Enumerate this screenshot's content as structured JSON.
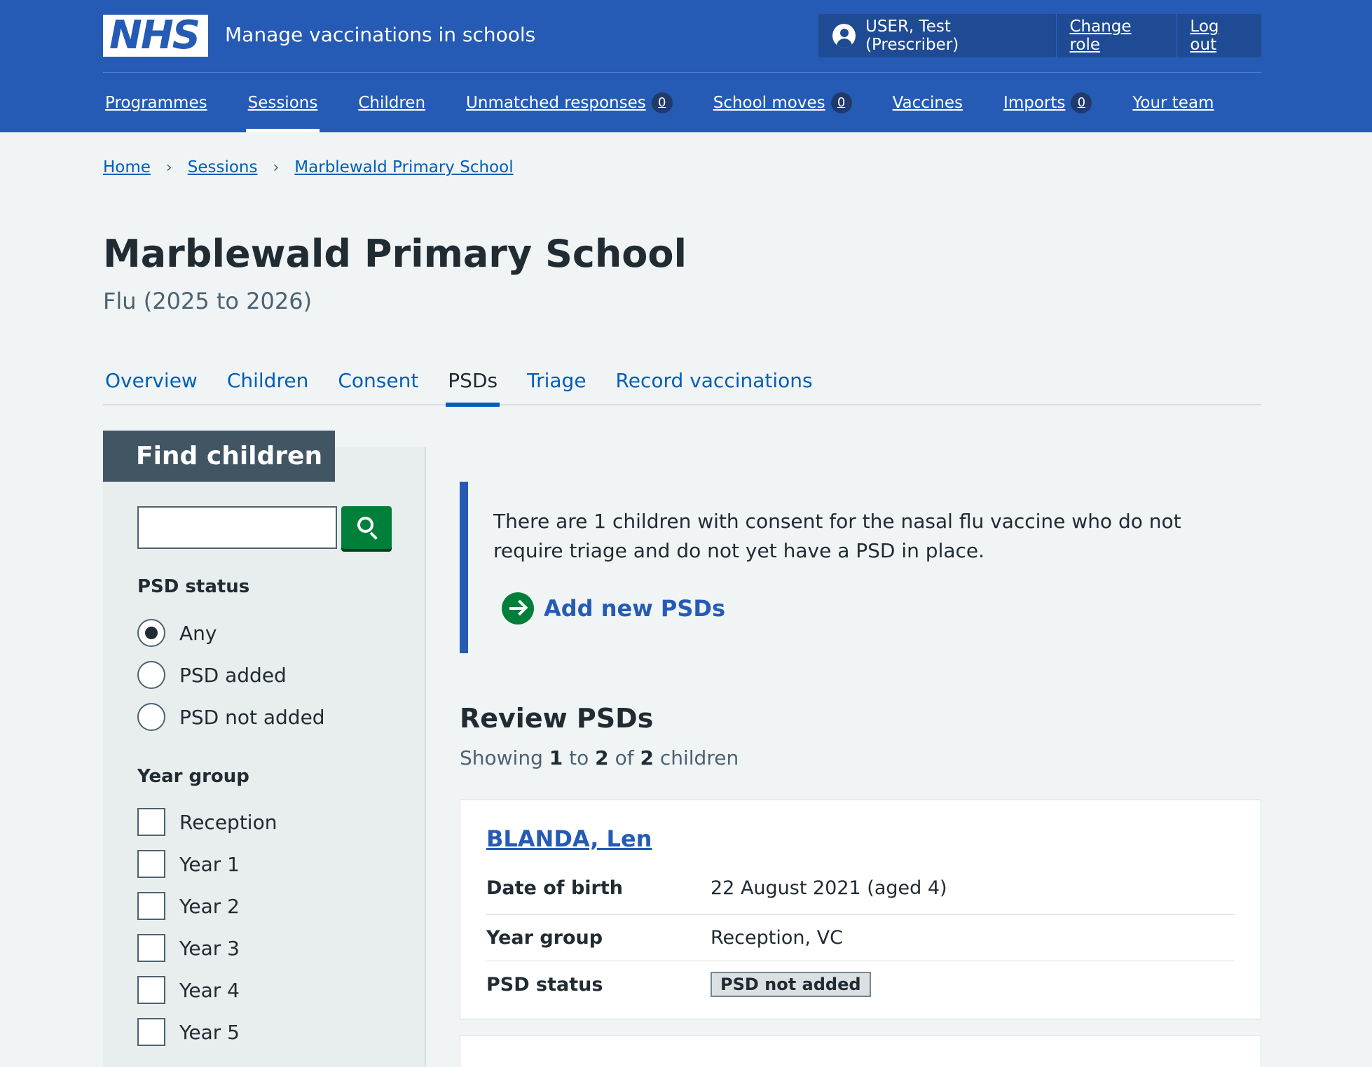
{
  "header": {
    "logo": "NHS",
    "service_name": "Manage vaccinations in schools",
    "user": "USER, Test (Prescriber)",
    "change_role": "Change role",
    "log_out": "Log out",
    "bg_color": "#255bb4"
  },
  "nav": {
    "items": [
      {
        "label": "Programmes"
      },
      {
        "label": "Sessions",
        "active": true
      },
      {
        "label": "Children"
      },
      {
        "label": "Unmatched responses",
        "badge": "0"
      },
      {
        "label": "School moves",
        "badge": "0"
      },
      {
        "label": "Vaccines"
      },
      {
        "label": "Imports",
        "badge": "0"
      },
      {
        "label": "Your team"
      }
    ]
  },
  "breadcrumb": [
    "Home",
    "Sessions",
    "Marblewald Primary School"
  ],
  "page": {
    "title": "Marblewald Primary School",
    "caption": "Flu (2025 to 2026)"
  },
  "tabs": [
    {
      "label": "Overview"
    },
    {
      "label": "Children"
    },
    {
      "label": "Consent"
    },
    {
      "label": "PSDs",
      "active": true
    },
    {
      "label": "Triage"
    },
    {
      "label": "Record vaccinations"
    }
  ],
  "filters": {
    "heading": "Find children",
    "search_value": "",
    "psd_status_label": "PSD status",
    "psd_status_options": [
      {
        "label": "Any",
        "checked": true
      },
      {
        "label": "PSD added",
        "checked": false
      },
      {
        "label": "PSD not added",
        "checked": false
      }
    ],
    "year_group_label": "Year group",
    "year_group_options": [
      "Reception",
      "Year 1",
      "Year 2",
      "Year 3",
      "Year 4",
      "Year 5"
    ]
  },
  "inset": {
    "text": "There are 1 children with consent for the nasal flu vaccine who do not require triage and do not yet have a PSD in place.",
    "action_label": "Add new PSDs"
  },
  "review": {
    "heading": "Review PSDs",
    "showing_prefix": "Showing",
    "from": "1",
    "to_word": "to",
    "to": "2",
    "of_word": "of",
    "total": "2",
    "suffix": "children"
  },
  "children": [
    {
      "name": "BLANDA, Len",
      "date_of_birth_label": "Date of birth",
      "date_of_birth": "22 August 2021 (aged 4)",
      "year_group_label": "Year group",
      "year_group": "Reception, VC",
      "psd_status_label": "PSD status",
      "psd_status": "PSD not added"
    }
  ]
}
